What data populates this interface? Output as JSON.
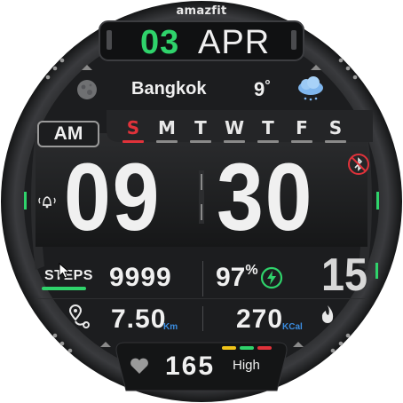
{
  "brand": "amazfit",
  "date": {
    "day": "03",
    "month": "APR"
  },
  "weather": {
    "city": "Bangkok",
    "temperature": "9",
    "unit": "°",
    "icon": "cloud-rain-icon"
  },
  "period": "AM",
  "weekdays": [
    {
      "label": "S",
      "active": true
    },
    {
      "label": "M",
      "active": false
    },
    {
      "label": "T",
      "active": false
    },
    {
      "label": "W",
      "active": false
    },
    {
      "label": "T",
      "active": false
    },
    {
      "label": "F",
      "active": false
    },
    {
      "label": "S",
      "active": false
    }
  ],
  "time": {
    "hours": "09",
    "minutes": "30",
    "seconds": "15"
  },
  "steps": {
    "label": "STEPS",
    "value": "9999"
  },
  "battery": {
    "value": "97",
    "unit": "%"
  },
  "distance": {
    "value": "7.50",
    "unit": "Km"
  },
  "calories": {
    "value": "270",
    "unit": "KCal"
  },
  "heart_rate": {
    "value": "165",
    "zone": "High"
  },
  "colors": {
    "accent_green": "#2fd36b",
    "accent_red": "#e0323a",
    "accent_blue": "#3b8de0",
    "zone_yellow": "#f0c419",
    "zone_red": "#e0323a"
  }
}
